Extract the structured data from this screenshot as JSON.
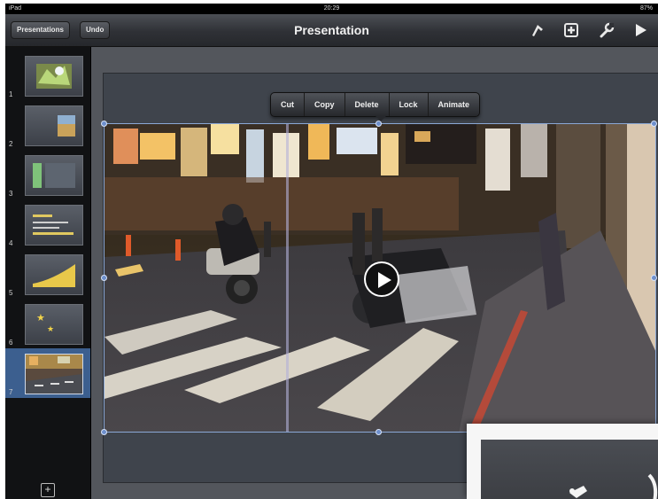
{
  "status_bar": {
    "left": "iPad",
    "time": "20:29",
    "right": "87%"
  },
  "toolbar": {
    "presentations_label": "Presentations",
    "undo_label": "Undo",
    "title": "Presentation",
    "icons": [
      "format-brush-icon",
      "insert-media-icon",
      "wrench-settings-icon",
      "play-slideshow-icon"
    ]
  },
  "sidebar": {
    "slides": [
      {
        "number": "1",
        "selected": false,
        "preview": "map-image"
      },
      {
        "number": "2",
        "selected": false,
        "preview": "image-right"
      },
      {
        "number": "3",
        "selected": false,
        "preview": "green-bar"
      },
      {
        "number": "4",
        "selected": false,
        "preview": "bar-chart"
      },
      {
        "number": "5",
        "selected": false,
        "preview": "area-chart"
      },
      {
        "number": "6",
        "selected": false,
        "preview": "stars"
      },
      {
        "number": "7",
        "selected": true,
        "preview": "street-photo"
      }
    ],
    "add_slide_icon": "add-slide-icon"
  },
  "context_menu": {
    "items": [
      "Cut",
      "Copy",
      "Delete",
      "Lock",
      "Animate"
    ]
  },
  "media": {
    "play_icon": "play-icon"
  },
  "colors": {
    "selection": "#3c5f8f",
    "handle": "#6d8fcc",
    "toolbar": "#2f3136"
  }
}
